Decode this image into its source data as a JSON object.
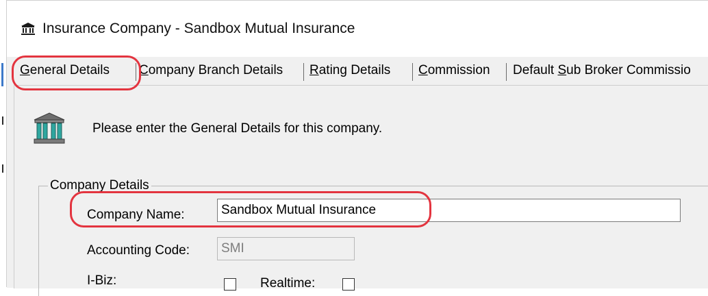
{
  "window": {
    "title": "Insurance Company - Sandbox Mutual Insurance",
    "icon": "bank-icon"
  },
  "tabs": [
    {
      "label": "General Details",
      "mnemonic": "G",
      "rest": "eneral Details"
    },
    {
      "label": "Company Branch Details",
      "mnemonic": "C",
      "rest": "ompany Branch Details"
    },
    {
      "label": "Rating Details",
      "mnemonic": "R",
      "rest": "ating Details"
    },
    {
      "label": "Commission",
      "mnemonic": "C",
      "rest": "ommission"
    },
    {
      "label": "Default Sub Broker Commissio",
      "before": "Default ",
      "mnemonic": "S",
      "rest": "ub Broker Commissio"
    }
  ],
  "intro": {
    "text": "Please enter the General Details for this company.",
    "icon": "bank-icon"
  },
  "company_details": {
    "legend": "Company Details",
    "company_name_label": "Company Name:",
    "company_name_value": "Sandbox Mutual Insurance",
    "accounting_code_label": "Accounting Code:",
    "accounting_code_value": "SMI",
    "ibiz_label": "I-Biz:",
    "realtime_label": "Realtime:"
  },
  "colors": {
    "highlight": "#e3343f",
    "window_bg": "#f0f0f0"
  }
}
